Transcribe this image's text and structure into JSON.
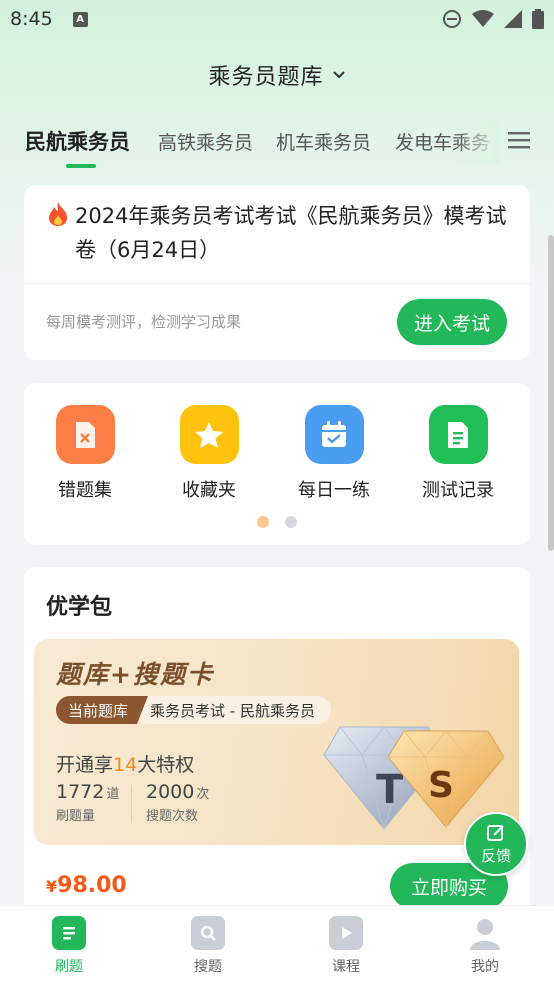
{
  "status": {
    "time": "8:45",
    "app_indicator": "A"
  },
  "header": {
    "title": "乘务员题库"
  },
  "tabs": [
    {
      "label": "民航乘务员",
      "active": true
    },
    {
      "label": "高铁乘务员"
    },
    {
      "label": "机车乘务员"
    },
    {
      "label": "发电车乘务员"
    }
  ],
  "exam": {
    "title": "2024年乘务员考试考试《民航乘务员》模考试卷（6月24日）",
    "subtitle": "每周模考测评，检测学习成果",
    "button": "进入考试"
  },
  "shortcuts": [
    {
      "label": "错题集",
      "icon": "wrong-book-icon",
      "color": "#fb7e45"
    },
    {
      "label": "收藏夹",
      "icon": "star-icon",
      "color": "#ffc20e"
    },
    {
      "label": "每日一练",
      "icon": "calendar-icon",
      "color": "#4a9cf0"
    },
    {
      "label": "测试记录",
      "icon": "document-icon",
      "color": "#1fbe57"
    }
  ],
  "package": {
    "title": "优学包",
    "banner": {
      "title": "题库+搜题卡",
      "tag_label": "当前题库",
      "tag_value": "乘务员考试 - 民航乘务员",
      "privilege_prefix": "开通享",
      "privilege_count": "14",
      "privilege_suffix": "大特权",
      "stats": [
        {
          "num": "1772",
          "unit": "道",
          "label": "刷题量"
        },
        {
          "num": "2000",
          "unit": "次",
          "label": "搜题次数"
        }
      ],
      "gem_left": "T",
      "gem_right": "S"
    },
    "price_symbol": "¥",
    "price": "98.00",
    "buy_button": "立即购买"
  },
  "feedback": {
    "label": "反馈"
  },
  "bottom_nav": [
    {
      "label": "刷题",
      "active": true
    },
    {
      "label": "搜题"
    },
    {
      "label": "课程"
    },
    {
      "label": "我的"
    }
  ],
  "colors": {
    "accent": "#22b85a",
    "price": "#f45a14",
    "highlight": "#f18b1b"
  }
}
